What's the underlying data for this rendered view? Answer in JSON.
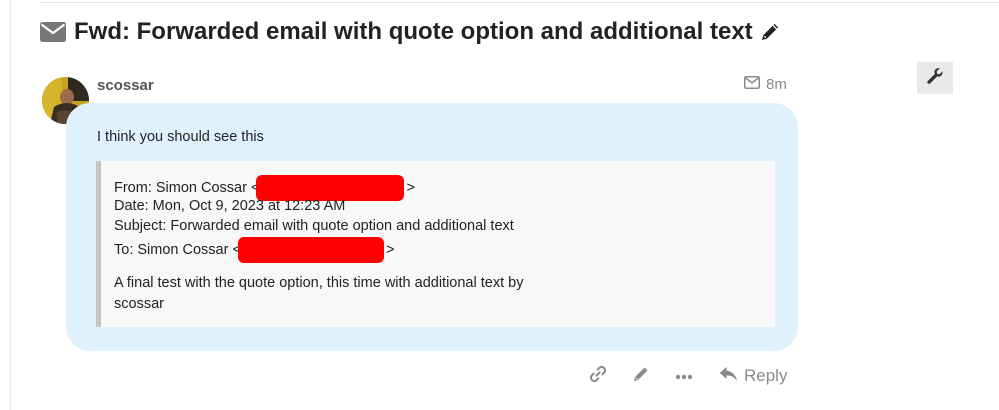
{
  "topic": {
    "title": "Fwd: Forwarded email with quote option and additional text",
    "title_icon": "envelope-icon",
    "edit_icon": "pencil-icon"
  },
  "admin": {
    "wrench_icon": "wrench-icon"
  },
  "post": {
    "username": "scossar",
    "timestamp": "8m",
    "meta_icon": "envelope-outline-icon",
    "intro": "I think you should see this",
    "quote": {
      "from_prefix": "From: Simon Cossar <",
      "from_suffix": ">",
      "date_line": "Date: Mon, Oct 9, 2023 at 12:23 AM",
      "subject_line": "Subject: Forwarded email with quote option and additional text",
      "to_prefix": "To: Simon Cossar <",
      "to_suffix": ">",
      "body_line1": "A final test with the quote option, this time with additional text by",
      "body_line2": "scossar"
    },
    "redaction_color": "#ff0000"
  },
  "actions": {
    "link_icon": "link-icon",
    "edit_icon": "pencil-icon",
    "more_icon": "ellipsis-icon",
    "reply_icon": "reply-icon",
    "reply_label": "Reply"
  },
  "colors": {
    "bubble_bg": "#dff2fc",
    "quote_bg": "#f8f8f8",
    "quote_border": "#c4c4c4",
    "muted": "#8a8a8a",
    "title": "#222222"
  }
}
